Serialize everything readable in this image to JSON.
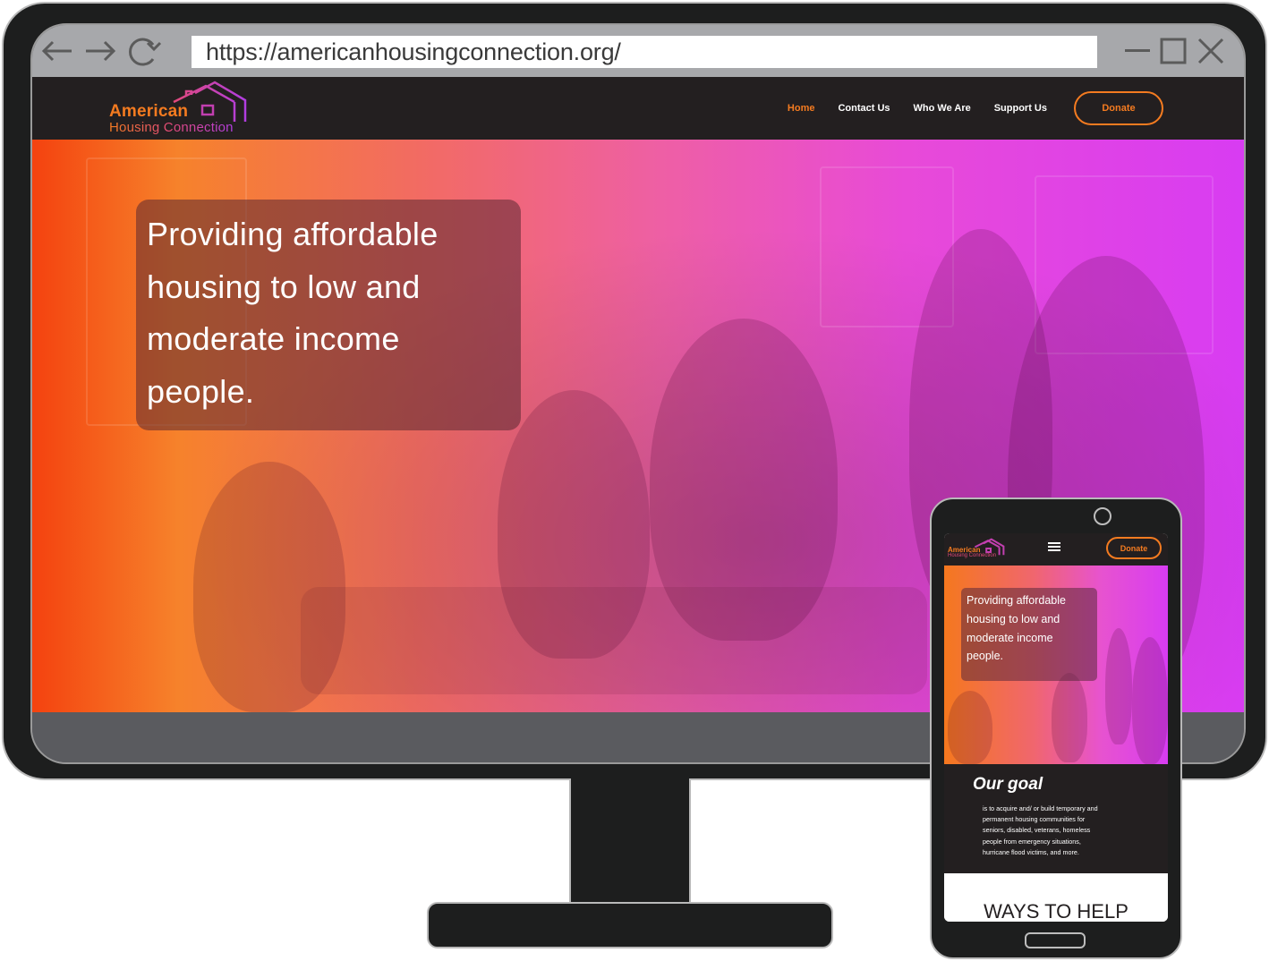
{
  "browser": {
    "url": "https://americanhousingconnection.org/",
    "back_icon": "arrow-left-icon",
    "forward_icon": "arrow-right-icon",
    "reload_icon": "reload-icon",
    "window_controls": [
      "minimize-icon",
      "maximize-icon",
      "close-icon"
    ]
  },
  "site": {
    "logo": {
      "line1": "American",
      "line2": "Housing Connection"
    },
    "nav": [
      {
        "label": "Home",
        "active": true
      },
      {
        "label": "Contact Us",
        "active": false
      },
      {
        "label": "Who We Are",
        "active": false
      },
      {
        "label": "Support Us",
        "active": false
      }
    ],
    "donate_label": "Donate",
    "hero": {
      "lines": [
        "Providing affordable",
        "housing to low and",
        "moderate income",
        "people."
      ]
    }
  },
  "mobile": {
    "logo": {
      "line1": "American",
      "line2": "Housing Connection"
    },
    "menu_icon": "hamburger-menu-icon",
    "donate_label": "Donate",
    "hero": {
      "lines": [
        "Providing affordable",
        "housing to low and",
        "moderate income",
        "people."
      ]
    },
    "goal": {
      "title": "Our goal",
      "lines": [
        "is to acquire and/ or build temporary and",
        "permanent housing communities for",
        "seniors, disabled, veterans, homeless",
        "people from emergency situations,",
        "hurricane flood victims, and more."
      ]
    },
    "ways_title": "WAYS TO HELP"
  },
  "colors": {
    "accent_orange": "#f47b20",
    "header_dark": "#231f20",
    "gradient_pink": "#ee5fa5",
    "gradient_purple": "#d83cf2"
  }
}
